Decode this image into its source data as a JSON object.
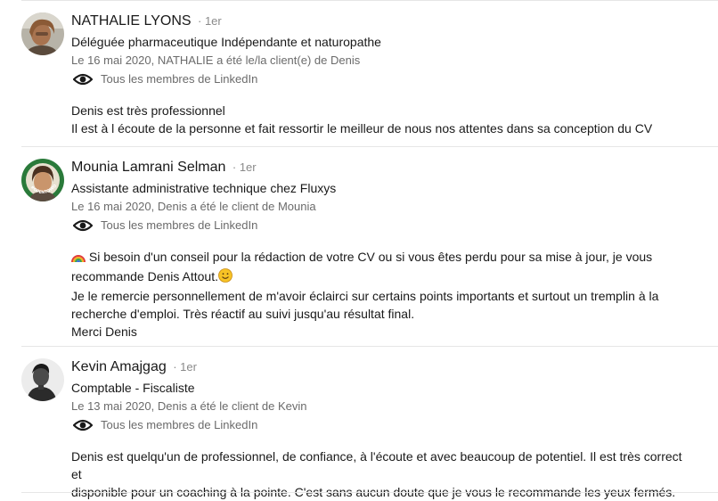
{
  "recommendations": [
    {
      "name": "NATHALIE LYONS",
      "degree": "· 1er",
      "headline": "Déléguée pharmaceutique Indépendante et naturopathe",
      "meta": "Le 16 mai 2020, NATHALIE a été le/la client(e) de Denis",
      "visibility": "Tous les membres de LinkedIn",
      "text": [
        "Denis est très professionnel",
        "Il est à l écoute de la personne et fait ressortir le meilleur de nous nos attentes dans sa conception du CV"
      ]
    },
    {
      "name": "Mounia Lamrani Selman",
      "degree": "· 1er",
      "headline": "Assistante administrative technique chez Fluxys",
      "meta": "Le 16 mai 2020, Denis a été le client de Mounia",
      "visibility": "Tous les membres de LinkedIn",
      "text": [
        "Si besoin d'un conseil pour la rédaction de votre CV ou si vous êtes perdu pour sa mise à jour, je vous",
        "recommande Denis Attout.",
        "Je le remercie personnellement de m'avoir éclairci sur certains points importants et surtout un tremplin à la",
        "recherche d'emploi. Très réactif au suivi jusqu'au résultat final.",
        "Merci Denis"
      ],
      "avatar_badge": "#OPENTOWORK"
    },
    {
      "name": "Kevin Amajgag",
      "degree": "· 1er",
      "headline": "Comptable - Fiscaliste",
      "meta": "Le 13 mai 2020, Denis a été le client de Kevin",
      "visibility": "Tous les membres de LinkedIn",
      "text": [
        "Denis est quelqu'un de professionnel, de confiance, à l'écoute et avec beaucoup de potentiel. Il est très correct et",
        "disponible pour un coaching à la pointe. C'est sans aucun doute que je vous le recommande les yeux fermés."
      ]
    }
  ],
  "icons": {
    "visibility": "eye-icon",
    "rainbow": "rainbow-emoji",
    "smile": "smiling-face-emoji"
  },
  "colors": {
    "text_primary": "#191919",
    "text_secondary": "#6b6b6b",
    "divider": "#e6e6e6",
    "open_to_work_ring": "#2a7a3a"
  }
}
